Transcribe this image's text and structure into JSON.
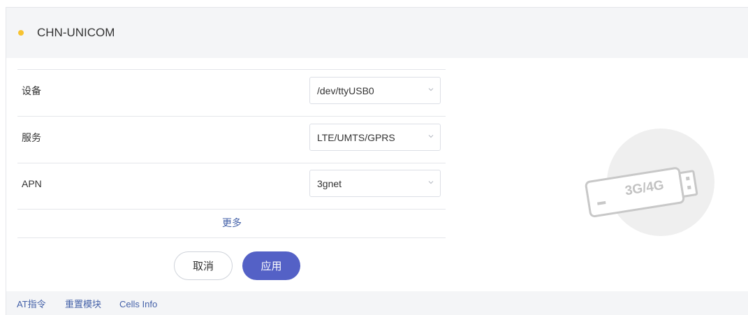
{
  "header": {
    "title": "CHN-UNICOM",
    "status_color": "#f7c331"
  },
  "form": {
    "fields": [
      {
        "label": "设备",
        "value": "/dev/ttyUSB0"
      },
      {
        "label": "服务",
        "value": "LTE/UMTS/GPRS"
      },
      {
        "label": "APN",
        "value": "3gnet"
      }
    ],
    "more_label": "更多",
    "cancel_label": "取消",
    "apply_label": "应用"
  },
  "illustration": {
    "label": "3G/4G",
    "icon": "usb-modem-icon"
  },
  "footer": {
    "links": [
      "AT指令",
      "重置模块",
      "Cells Info"
    ]
  },
  "colors": {
    "accent": "#5461c6",
    "link": "#4461a8",
    "header_bg": "#f4f5f7"
  }
}
